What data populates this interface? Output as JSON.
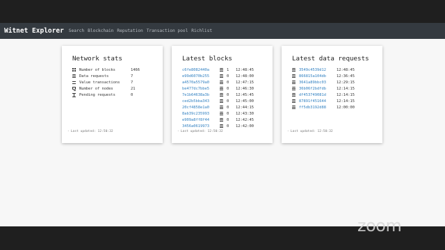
{
  "navbar": {
    "brand": "Witnet Explorer",
    "links": [
      "Search",
      "Blockchain",
      "Reputation",
      "Transaction pool",
      "Richlist"
    ]
  },
  "network_stats": {
    "title": "Network stats",
    "rows": [
      {
        "icon": "cubes-icon",
        "label": "Number of blocks",
        "value": "1466"
      },
      {
        "icon": "database-icon",
        "label": "Data requests",
        "value": "7"
      },
      {
        "icon": "exchange-icon",
        "label": "Value transactions",
        "value": "7"
      },
      {
        "icon": "desktop-icon",
        "label": "Number of nodes",
        "value": "21"
      },
      {
        "icon": "hourglass-icon",
        "label": "Pending requests",
        "value": "0"
      }
    ],
    "footer": "Last updated: 12:50:32"
  },
  "latest_blocks": {
    "title": "Latest blocks",
    "rows": [
      {
        "hash": "c6fe8082440a",
        "count": "1",
        "time": "12:48:45"
      },
      {
        "hash": "e99d6070b255",
        "count": "0",
        "time": "12:48:00"
      },
      {
        "hash": "a4570a5579a0",
        "count": "0",
        "time": "12:47:15"
      },
      {
        "hash": "be477dc7bbe5",
        "count": "0",
        "time": "12:46:30"
      },
      {
        "hash": "7e1b64638a3b",
        "count": "0",
        "time": "12:45:45"
      },
      {
        "hash": "ced2b5bba343",
        "count": "0",
        "time": "12:45:00"
      },
      {
        "hash": "20cf4858e1a0",
        "count": "0",
        "time": "12:44:15"
      },
      {
        "hash": "8ab39c235993",
        "count": "0",
        "time": "12:43:30"
      },
      {
        "hash": "e909a8ff8f44",
        "count": "0",
        "time": "12:42:45"
      },
      {
        "hash": "3456a0619973",
        "count": "0",
        "time": "12:42:00"
      }
    ],
    "footer": "Last updated: 12:50:32"
  },
  "latest_data_requests": {
    "title": "Latest data requests",
    "rows": [
      {
        "hash": "3549c4539d12",
        "time": "12:48:45"
      },
      {
        "hash": "866815a104db",
        "time": "12:36:45"
      },
      {
        "hash": "3641a89bbc03",
        "time": "12:29:15"
      },
      {
        "hash": "36b06f2bdfdb",
        "time": "12:14:15"
      },
      {
        "hash": "df453749081d",
        "time": "12:14:15"
      },
      {
        "hash": "87891f451644",
        "time": "12:14:15"
      },
      {
        "hash": "ff5db3192d88",
        "time": "12:00:00"
      }
    ],
    "footer": "Last updated: 12:50:32"
  },
  "overlay": {
    "zoom_logo": "zoom"
  },
  "colors": {
    "navbar_bg": "#343a40",
    "link": "#2f7fc0",
    "page_bg": "#f7f7f7",
    "frame": "#1f1f1f"
  }
}
